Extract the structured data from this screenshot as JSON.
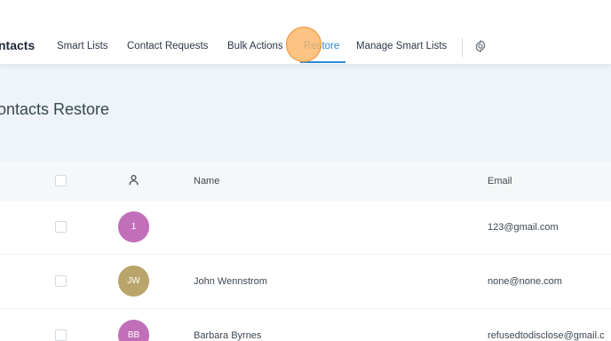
{
  "app": {
    "section_title": "ntacts"
  },
  "nav": {
    "items": [
      {
        "label": "Smart Lists"
      },
      {
        "label": "Contact Requests"
      },
      {
        "label": "Bulk Actions"
      },
      {
        "label": "Restore",
        "active": true
      },
      {
        "label": "Manage Smart Lists"
      }
    ],
    "settings_icon": "gear-icon"
  },
  "page": {
    "title": "ontacts Restore"
  },
  "table": {
    "columns": [
      "",
      "person-icon",
      "Name",
      "Email"
    ],
    "headers": {
      "name": "Name",
      "email": "Email"
    },
    "rows": [
      {
        "initials": "1",
        "name": "",
        "email": "123@gmail.com",
        "avatar_color": "#c06fb8"
      },
      {
        "initials": "JW",
        "name": "John Wennstrom",
        "email": "none@none.com",
        "avatar_color": "#b9a46a"
      },
      {
        "initials": "BB",
        "name": "Barbara Byrnes",
        "email": "refusedtodisclose@gmail.c",
        "avatar_color": "#c06fb8"
      }
    ]
  },
  "colors": {
    "accent": "#2b8ad6",
    "header_band": "#eef4f8",
    "click_marker": "#fbb25f"
  }
}
